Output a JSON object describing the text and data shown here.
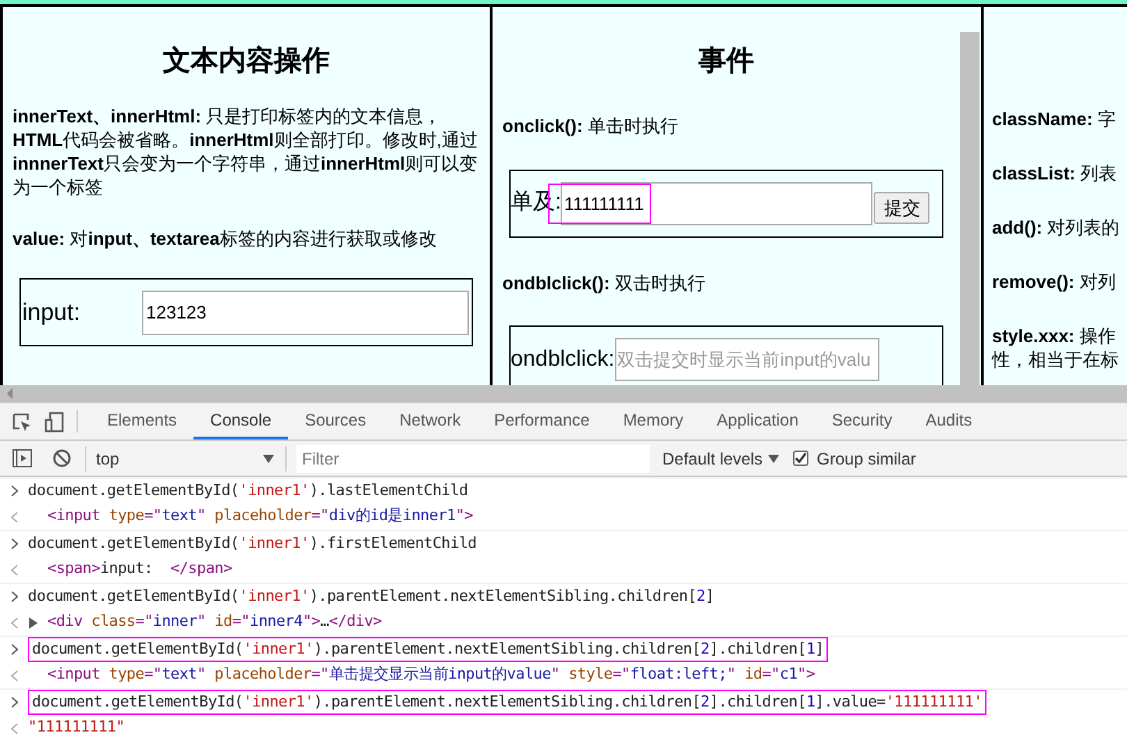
{
  "panels": [
    {
      "kind": "text",
      "title": "文本内容操作",
      "paragraphs": [
        "**innerText、innerHtml:** 只是打印标签内的文本信息，**HTML**代码会被省略。**innerHtml**则全部打印。修改时,通过**innnerText**只会变为一个字符串，通过**innerHtml**则可以变为一个标签",
        "**value:** 对**input、textarea**标签的内容进行获取或修改"
      ],
      "demos": [
        {
          "label": "input:",
          "value": "123123"
        }
      ]
    },
    {
      "kind": "events",
      "title": "事件",
      "sections": [
        {
          "heading": "**onclick():** 单击时执行",
          "label": "单及:",
          "value": "111111111",
          "button": "提交",
          "highlighted": true
        },
        {
          "heading": "**ondblclick():** 双击时执行",
          "label": "ondblclick:",
          "placeholder": "双击提交时显示当前input的valu",
          "highlighted": false
        }
      ]
    },
    {
      "kind": "list",
      "items": [
        [
          "**className:** 字"
        ],
        [
          "**classList:** 列表"
        ],
        [
          "**add():** 对列表的"
        ],
        [
          "**remove():** 对列"
        ],
        [
          "**style.xxx:** 操作",
          "性，相当于在标"
        ]
      ]
    }
  ],
  "devtools": {
    "tabs": [
      {
        "label": "Elements",
        "selected": false
      },
      {
        "label": "Console",
        "selected": true
      },
      {
        "label": "Sources",
        "selected": false
      },
      {
        "label": "Network",
        "selected": false
      },
      {
        "label": "Performance",
        "selected": false
      },
      {
        "label": "Memory",
        "selected": false
      },
      {
        "label": "Application",
        "selected": false
      },
      {
        "label": "Security",
        "selected": false
      },
      {
        "label": "Audits",
        "selected": false
      }
    ],
    "context": "top",
    "filter_placeholder": "Filter",
    "levels": "Default levels",
    "group_similar": {
      "label": "Group similar",
      "checked": true
    }
  },
  "console": [
    {
      "kind": "input",
      "highlighted": false,
      "tokens": [
        {
          "kind": "plain",
          "t": "document.getElementById("
        },
        {
          "kind": "str",
          "t": "'inner1'"
        },
        {
          "kind": "plain",
          "t": ").lastElementChild"
        }
      ]
    },
    {
      "kind": "output",
      "expandable": false,
      "tokens": [
        {
          "kind": "tag",
          "t": "<input "
        },
        {
          "kind": "attr",
          "t": "type"
        },
        {
          "kind": "tag",
          "t": "=\""
        },
        {
          "kind": "val",
          "t": "text"
        },
        {
          "kind": "tag",
          "t": "\" "
        },
        {
          "kind": "attr",
          "t": "placeholder"
        },
        {
          "kind": "tag",
          "t": "=\""
        },
        {
          "kind": "val",
          "t": "div的id是inner1"
        },
        {
          "kind": "tag",
          "t": "\">"
        }
      ]
    },
    {
      "kind": "input",
      "highlighted": false,
      "tokens": [
        {
          "kind": "plain",
          "t": "document.getElementById("
        },
        {
          "kind": "str",
          "t": "'inner1'"
        },
        {
          "kind": "plain",
          "t": ").firstElementChild"
        }
      ]
    },
    {
      "kind": "output",
      "expandable": false,
      "tokens": [
        {
          "kind": "tag",
          "t": "<span>"
        },
        {
          "kind": "plain",
          "t": "input:  "
        },
        {
          "kind": "tag",
          "t": "</span>"
        }
      ]
    },
    {
      "kind": "input",
      "highlighted": false,
      "tokens": [
        {
          "kind": "plain",
          "t": "document.getElementById("
        },
        {
          "kind": "str",
          "t": "'inner1'"
        },
        {
          "kind": "plain",
          "t": ").parentElement.nextElementSibling.children["
        },
        {
          "kind": "num",
          "t": "2"
        },
        {
          "kind": "plain",
          "t": "]"
        }
      ]
    },
    {
      "kind": "output",
      "expandable": true,
      "tokens": [
        {
          "kind": "tag",
          "t": "<div "
        },
        {
          "kind": "attr",
          "t": "class"
        },
        {
          "kind": "tag",
          "t": "=\""
        },
        {
          "kind": "val",
          "t": "inner"
        },
        {
          "kind": "tag",
          "t": "\" "
        },
        {
          "kind": "attr",
          "t": "id"
        },
        {
          "kind": "tag",
          "t": "=\""
        },
        {
          "kind": "val",
          "t": "inner4"
        },
        {
          "kind": "tag",
          "t": "\">"
        },
        {
          "kind": "plain",
          "t": "…"
        },
        {
          "kind": "tag",
          "t": "</div>"
        }
      ]
    },
    {
      "kind": "input",
      "highlighted": true,
      "tokens": [
        {
          "kind": "plain",
          "t": "document.getElementById("
        },
        {
          "kind": "str",
          "t": "'inner1'"
        },
        {
          "kind": "plain",
          "t": ").parentElement.nextElementSibling.children["
        },
        {
          "kind": "num",
          "t": "2"
        },
        {
          "kind": "plain",
          "t": "].children["
        },
        {
          "kind": "num",
          "t": "1"
        },
        {
          "kind": "plain",
          "t": "]"
        }
      ]
    },
    {
      "kind": "output",
      "expandable": false,
      "tokens": [
        {
          "kind": "tag",
          "t": "<input "
        },
        {
          "kind": "attr",
          "t": "type"
        },
        {
          "kind": "tag",
          "t": "=\""
        },
        {
          "kind": "val",
          "t": "text"
        },
        {
          "kind": "tag",
          "t": "\" "
        },
        {
          "kind": "attr",
          "t": "placeholder"
        },
        {
          "kind": "tag",
          "t": "=\""
        },
        {
          "kind": "val",
          "t": "单击提交显示当前input的value"
        },
        {
          "kind": "tag",
          "t": "\" "
        },
        {
          "kind": "attr",
          "t": "style"
        },
        {
          "kind": "tag",
          "t": "=\""
        },
        {
          "kind": "val",
          "t": "float:left;"
        },
        {
          "kind": "tag",
          "t": "\" "
        },
        {
          "kind": "attr",
          "t": "id"
        },
        {
          "kind": "tag",
          "t": "=\""
        },
        {
          "kind": "val",
          "t": "c1"
        },
        {
          "kind": "tag",
          "t": "\">"
        }
      ]
    },
    {
      "kind": "input",
      "highlighted": true,
      "tokens": [
        {
          "kind": "plain",
          "t": "document.getElementById("
        },
        {
          "kind": "str",
          "t": "'inner1'"
        },
        {
          "kind": "plain",
          "t": ").parentElement.nextElementSibling.children["
        },
        {
          "kind": "num",
          "t": "2"
        },
        {
          "kind": "plain",
          "t": "].children["
        },
        {
          "kind": "num",
          "t": "1"
        },
        {
          "kind": "plain",
          "t": "].value="
        },
        {
          "kind": "str",
          "t": "'111111111'"
        }
      ]
    },
    {
      "kind": "result",
      "tokens": [
        {
          "kind": "str",
          "t": "\"111111111\""
        }
      ]
    }
  ]
}
